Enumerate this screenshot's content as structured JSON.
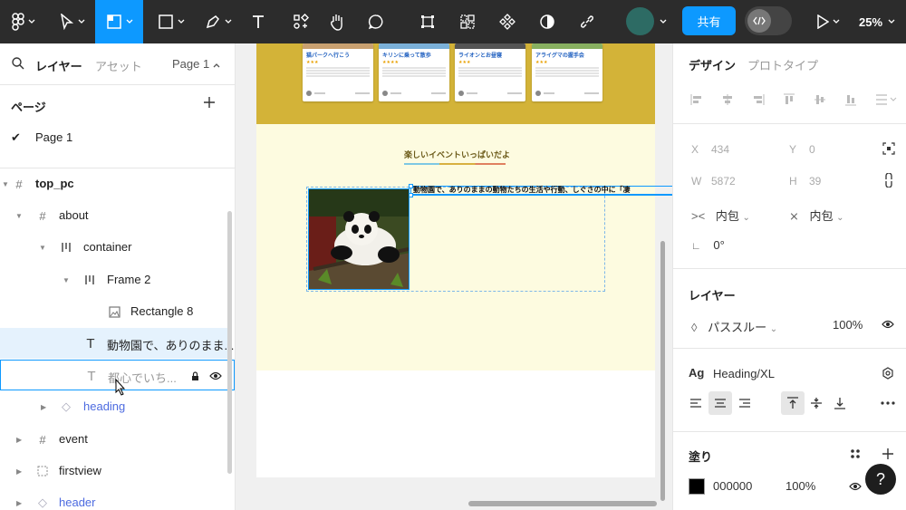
{
  "toolbar": {
    "share_label": "共有",
    "zoom_label": "25%",
    "icons": [
      "figma-menu-icon",
      "move-tool-icon",
      "frame-tool-icon",
      "shape-tool-icon",
      "pen-tool-icon",
      "text-tool-icon",
      "resources-icon",
      "hand-tool-icon",
      "comment-icon",
      "crop-icon",
      "component-icon",
      "components-set-icon",
      "theme-icon",
      "link-icon",
      "play-icon"
    ]
  },
  "left": {
    "tabs": {
      "layers": "レイヤー",
      "assets": "アセット",
      "page_selector": "Page 1"
    },
    "pages_heading": "ページ",
    "pages": [
      {
        "name": "Page 1",
        "checked": true
      }
    ],
    "layers": [
      {
        "name": "top_pc",
        "type": "frame",
        "indent": 0
      },
      {
        "name": "about",
        "type": "frame",
        "indent": 1
      },
      {
        "name": "container",
        "type": "autolayout",
        "indent": 2
      },
      {
        "name": "Frame 2",
        "type": "autolayout",
        "indent": 3
      },
      {
        "name": "Rectangle 8",
        "type": "image",
        "indent": 4
      },
      {
        "name": "動物園で、ありのまま...",
        "type": "text",
        "indent": 3,
        "selected": true
      },
      {
        "name": "都心でいち...",
        "type": "text",
        "indent": 3,
        "hover": true
      },
      {
        "name": "heading",
        "type": "component",
        "indent": 2
      },
      {
        "name": "event",
        "type": "frame",
        "indent": 1
      },
      {
        "name": "firstview",
        "type": "frame",
        "indent": 1
      },
      {
        "name": "header",
        "type": "component",
        "indent": 1
      }
    ]
  },
  "canvas": {
    "cards": [
      {
        "title": "猫パークへ行こう",
        "stars": "★★★"
      },
      {
        "title": "キリンに乗って散歩",
        "stars": "★★★★"
      },
      {
        "title": "ライオンとお昼寝",
        "stars": "★★★"
      },
      {
        "title": "アライグマの握手会",
        "stars": "★★★"
      }
    ],
    "section_title": "楽しいイベントいっぱいだよ",
    "body_text": "動物園で、ありのままの動物たちの生活や行動、しぐさの中に「凄"
  },
  "right": {
    "tabs": {
      "design": "デザイン",
      "prototype": "プロトタイプ"
    },
    "x": {
      "label": "X",
      "value": "434"
    },
    "y": {
      "label": "Y",
      "value": "0"
    },
    "w": {
      "label": "W",
      "value": "5872"
    },
    "h": {
      "label": "H",
      "value": "39"
    },
    "hug_w": "内包",
    "hug_h": "内包",
    "rotation": "0°",
    "layer_heading": "レイヤー",
    "blend_mode": "パススルー",
    "opacity": "100%",
    "text_style_icon": "Ag",
    "text_style": "Heading/XL",
    "fill_heading": "塗り",
    "fill_hex": "000000",
    "fill_opacity": "100%",
    "help_label": "?",
    "colors": {
      "accent": "#0d99ff",
      "toolbar": "#2c2c2c"
    }
  }
}
